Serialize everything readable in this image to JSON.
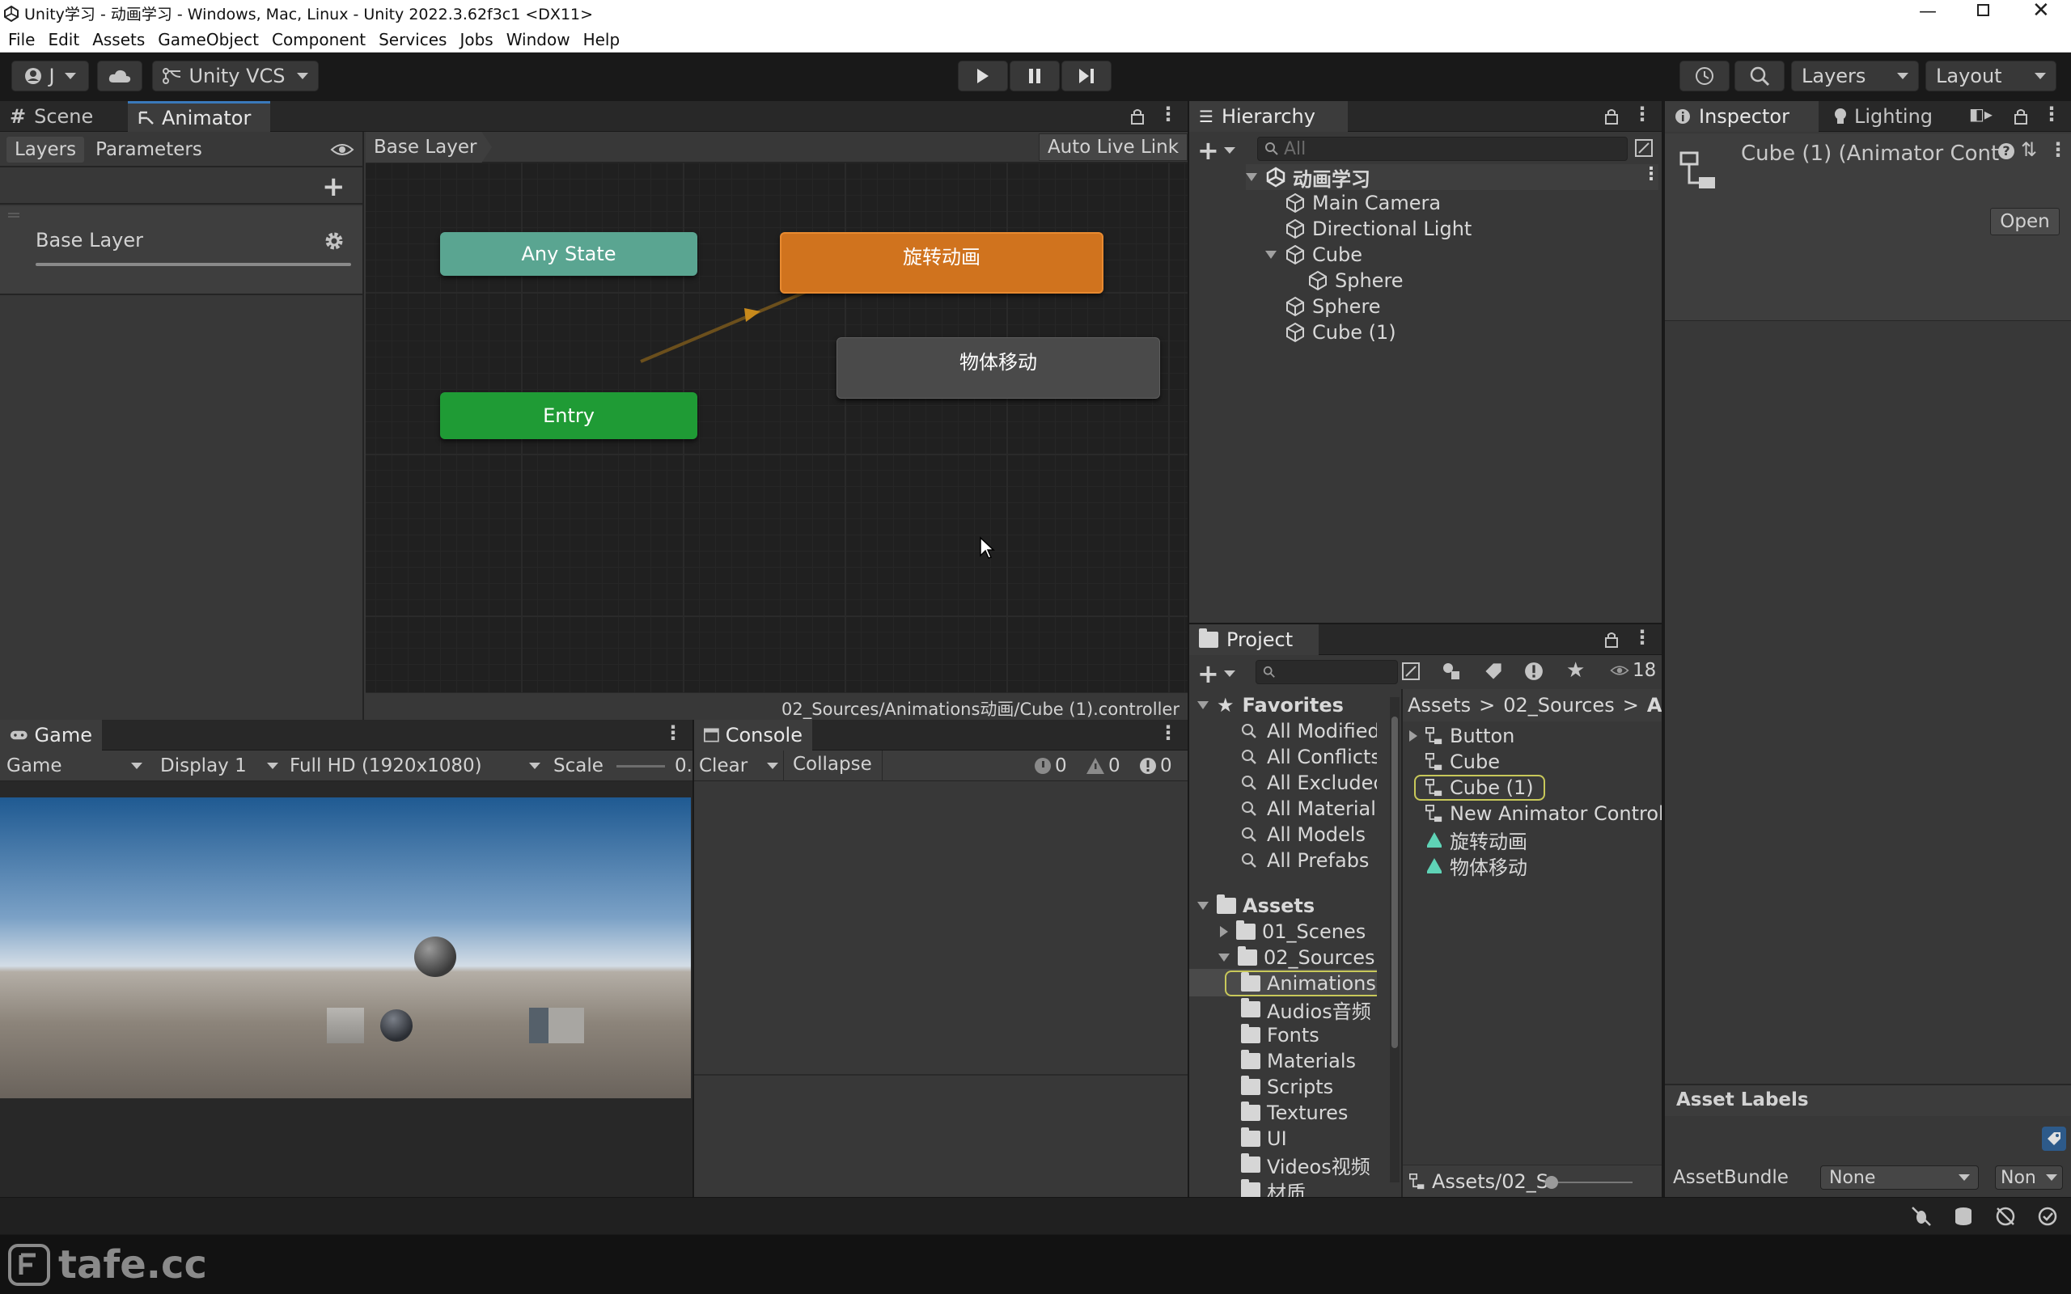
{
  "window": {
    "title": "Unity学习 - 动画学习 - Windows, Mac, Linux - Unity 2022.3.62f3c1 <DX11>"
  },
  "menu": [
    "File",
    "Edit",
    "Assets",
    "GameObject",
    "Component",
    "Services",
    "Jobs",
    "Window",
    "Help"
  ],
  "toolbar": {
    "account": "J",
    "vcs": "Unity VCS",
    "layers": "Layers",
    "layout": "Layout"
  },
  "animator": {
    "tabs": {
      "scene": "Scene",
      "animator": "Animator"
    },
    "sub_tabs": {
      "layers": "Layers",
      "parameters": "Parameters"
    },
    "layer_item": "Base Layer",
    "breadcrumb": "Base Layer",
    "auto_live_link": "Auto Live Link",
    "nodes": {
      "any_state": "Any State",
      "rotate": "旋转动画",
      "entry": "Entry",
      "move": "物体移动"
    },
    "footer_path": "02_Sources/Animations动画/Cube (1).controller"
  },
  "hierarchy": {
    "tab": "Hierarchy",
    "search_placeholder": "All",
    "scene": "动画学习",
    "items": [
      "Main Camera",
      "Directional Light",
      "Cube",
      "Sphere",
      "Sphere",
      "Cube (1)"
    ]
  },
  "inspector": {
    "tabs": {
      "inspector": "Inspector",
      "lighting": "Lighting"
    },
    "object_title": "Cube (1) (Animator Cont",
    "open_button": "Open",
    "asset_labels": "Asset Labels",
    "assetbundle_label": "AssetBundle",
    "assetbundle_value": "None",
    "variant_value": "Non"
  },
  "game": {
    "tab": "Game",
    "mode": "Game",
    "display": "Display 1",
    "resolution": "Full HD (1920x1080)",
    "scale_label": "Scale",
    "scale_value": "0."
  },
  "console": {
    "tab": "Console",
    "clear": "Clear",
    "collapse": "Collapse",
    "log_count": "0",
    "warn_count": "0",
    "error_count": "0"
  },
  "project": {
    "tab": "Project",
    "hidden_count": "18",
    "favorites_label": "Favorites",
    "favorites": [
      "All Modified",
      "All Conflicts",
      "All Excluded",
      "All Materials",
      "All Models",
      "All Prefabs"
    ],
    "assets_label": "Assets",
    "tree": [
      "01_Scenes",
      "02_Sources",
      "Animations",
      "Audios音频",
      "Fonts",
      "Materials",
      "Scripts",
      "Textures",
      "UI",
      "Videos视频",
      "材质"
    ],
    "breadcrumb": [
      "Assets",
      "02_Sources",
      "Ar"
    ],
    "files": [
      "Button",
      "Cube",
      "Cube (1)",
      "New Animator Control",
      "旋转动画",
      "物体移动"
    ],
    "footer_path": "Assets/02_S"
  },
  "watermark": "tafe.cc"
}
